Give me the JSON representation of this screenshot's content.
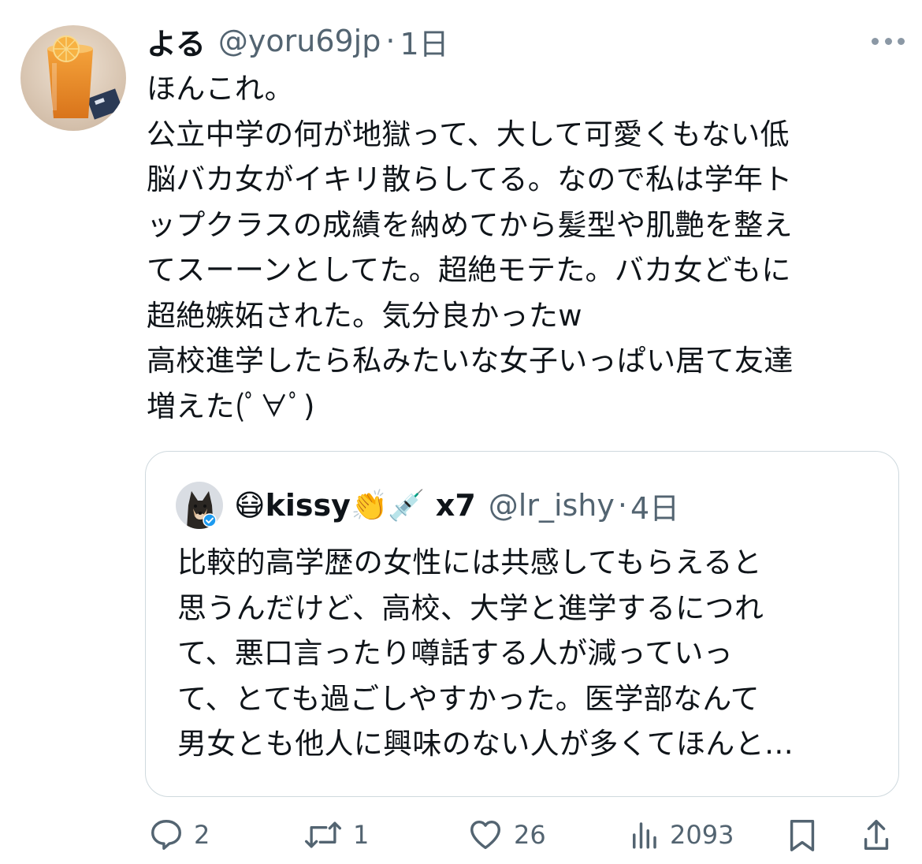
{
  "tweet": {
    "author": {
      "display_name": "よる",
      "handle": "@yoru69jp"
    },
    "separator": "·",
    "time": "1日",
    "text": "ほんこれ。\n公立中学の何が地獄って、大して可愛くもない低\n脳バカ女がイキリ散らしてる。なので私は学年ト\nップクラスの成績を納めてから髪型や肌艶を整え\nてスーーンとしてた。超絶モテた。バカ女どもに\n超絶嫉妬された。気分良かったw\n高校進学したら私みたいな女子いっぱい居て友達\n増えた(ﾟ∀ﾟ)",
    "more_icon": "more-dots-icon"
  },
  "quoted_tweet": {
    "author": {
      "display_name_prefix_emoji": "😷",
      "display_name_main": "kissy",
      "display_name_emojis": "👏💉",
      "display_name_suffix": " x7",
      "handle": "@lr_ishy",
      "verified_icon": "verified-badge-icon"
    },
    "separator": "·",
    "time": "4日",
    "text": "比較的高学歴の女性には共感してもらえると\n思うんだけど、高校、大学と進学するにつれ\nて、悪口言ったり噂話する人が減っていっ\nて、とても過ごしやすかった。医学部なんて\n男女とも他人に興味のない人が多くてほんと…"
  },
  "actions": {
    "reply": {
      "icon": "reply-icon",
      "count": "2"
    },
    "retweet": {
      "icon": "retweet-icon",
      "count": "1"
    },
    "like": {
      "icon": "heart-icon",
      "count": "26"
    },
    "views": {
      "icon": "views-chart-icon",
      "count": "2093"
    },
    "bookmark": {
      "icon": "bookmark-icon"
    },
    "share": {
      "icon": "share-icon"
    }
  },
  "colors": {
    "text": "#0f1419",
    "muted": "#536471",
    "border": "#cfd9de",
    "verified": "#1d9bf0"
  }
}
